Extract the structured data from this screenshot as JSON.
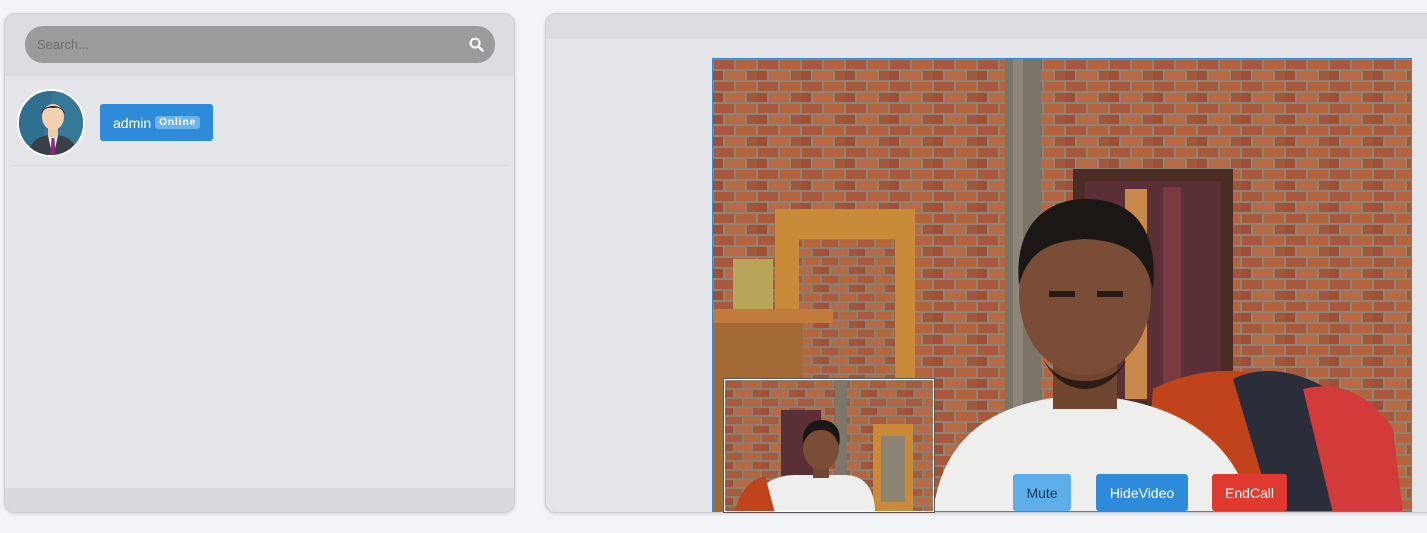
{
  "search": {
    "placeholder": "Search..."
  },
  "contacts": [
    {
      "name": "admin",
      "status": "Online"
    }
  ],
  "call_controls": {
    "mute_label": "Mute",
    "hide_video_label": "HideVideo",
    "end_call_label": "EndCall"
  },
  "colors": {
    "accent": "#2e8bd9",
    "mute": "#5eaeea",
    "end_call": "#e03a30",
    "panel": "#e4e5e8"
  },
  "icons": {
    "search": "search-icon",
    "avatar": "user-avatar-icon"
  }
}
